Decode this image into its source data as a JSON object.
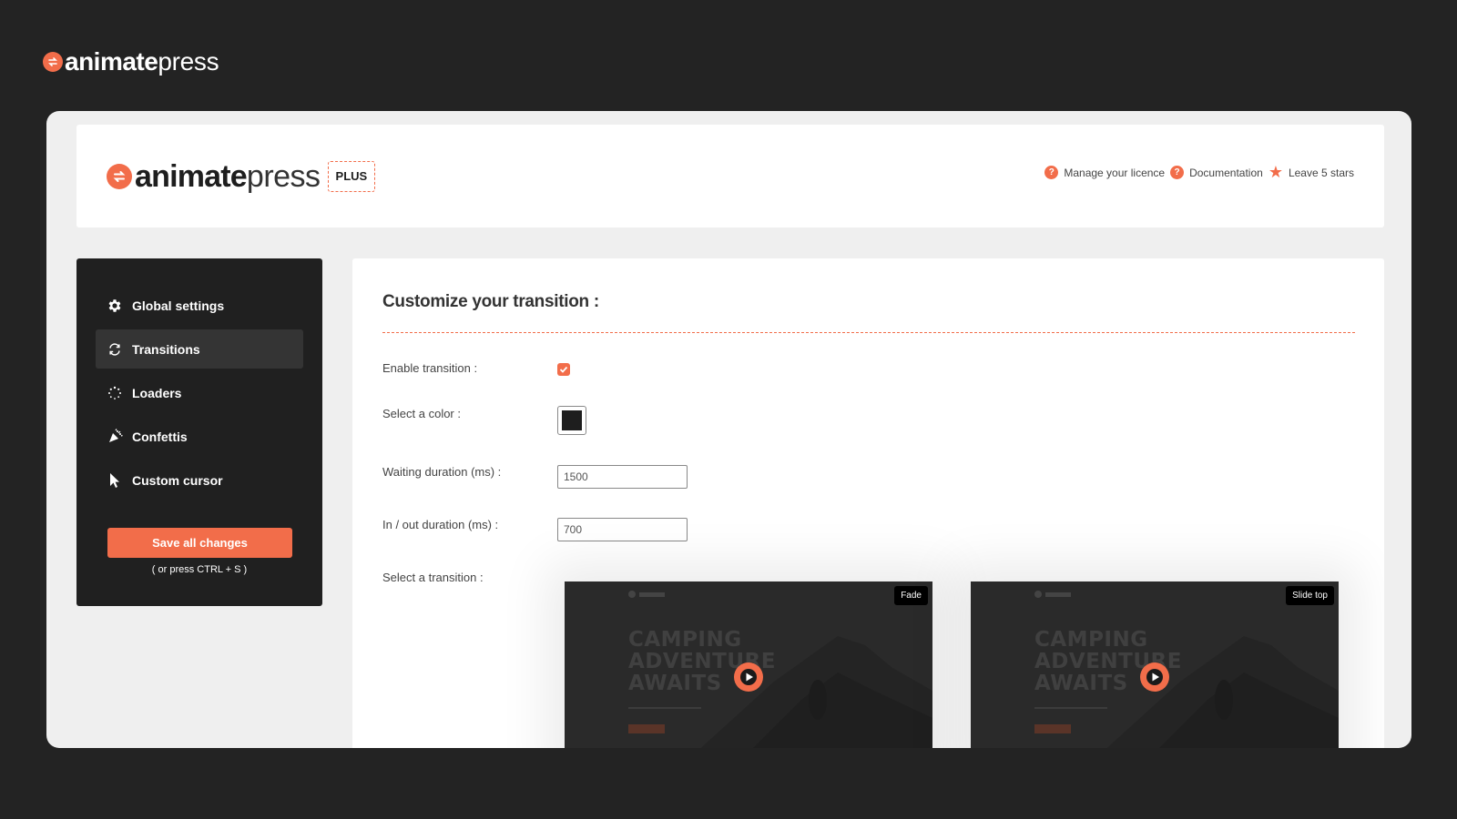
{
  "brand": {
    "name_bold": "animate",
    "name_light": "press",
    "badge": "PLUS"
  },
  "header": {
    "links": [
      {
        "label": "Manage your licence",
        "icon": "question-icon"
      },
      {
        "label": "Documentation",
        "icon": "question-icon"
      },
      {
        "label": "Leave 5 stars",
        "icon": "star-icon"
      }
    ]
  },
  "sidebar": {
    "items": [
      {
        "label": "Global settings",
        "icon": "gear-icon",
        "active": false
      },
      {
        "label": "Transitions",
        "icon": "refresh-icon",
        "active": true
      },
      {
        "label": "Loaders",
        "icon": "spinner-icon",
        "active": false
      },
      {
        "label": "Confettis",
        "icon": "party-popper-icon",
        "active": false
      },
      {
        "label": "Custom cursor",
        "icon": "cursor-icon",
        "active": false
      }
    ],
    "save_label": "Save all changes",
    "save_hint": "( or press CTRL + S )"
  },
  "main": {
    "title": "Customize your transition :",
    "enable_label": "Enable transition :",
    "enable_checked": true,
    "color_label": "Select a color :",
    "color_value": "#1e1e1e",
    "waiting_label": "Waiting duration (ms) :",
    "waiting_value": "1500",
    "inout_label": "In / out duration (ms) :",
    "inout_value": "700",
    "transition_label": "Select a transition :",
    "previews": [
      {
        "tag": "Fade",
        "hero": "CAMPING ADVENTURE AWAITS"
      },
      {
        "tag": "Slide top",
        "hero": "CAMPING ADVENTURE AWAITS"
      }
    ]
  },
  "colors": {
    "accent": "#f26d4a",
    "background": "#232323",
    "sidebar": "#202020",
    "panel": "#ffffff"
  }
}
